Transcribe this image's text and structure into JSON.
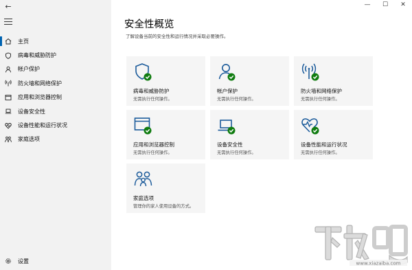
{
  "window": {
    "back_glyph": "←",
    "controls": [
      "—",
      "☐",
      "✕"
    ]
  },
  "sidebar": {
    "items": [
      {
        "label": "主页",
        "icon": "home-icon",
        "active": true
      },
      {
        "label": "病毒和威胁防护",
        "icon": "shield-icon"
      },
      {
        "label": "帐户保护",
        "icon": "person-icon"
      },
      {
        "label": "防火墙和网络保护",
        "icon": "wifi-icon"
      },
      {
        "label": "应用和浏览器控制",
        "icon": "app-window-icon"
      },
      {
        "label": "设备安全性",
        "icon": "laptop-icon"
      },
      {
        "label": "设备性能和运行状况",
        "icon": "heart-icon"
      },
      {
        "label": "家庭选项",
        "icon": "family-icon"
      }
    ],
    "settings_label": "设置"
  },
  "main": {
    "title": "安全性概览",
    "subtitle": "了解设备当前的安全性和运行情况并采取必要操作。",
    "tiles": [
      {
        "title": "病毒和威胁防护",
        "status": "无需执行任何操作。",
        "icon": "shield-check-icon"
      },
      {
        "title": "帐户保护",
        "status": "无需执行任何操作。",
        "icon": "person-check-icon"
      },
      {
        "title": "防火墙和网络保护",
        "status": "无需执行任何操作。",
        "icon": "wifi-check-icon"
      },
      {
        "title": "应用和浏览器控制",
        "status": "无需执行任何操作。",
        "icon": "app-window-check-icon"
      },
      {
        "title": "设备安全性",
        "status": "无需执行任何操作。",
        "icon": "laptop-check-icon"
      },
      {
        "title": "设备性能和运行状况",
        "status": "无需执行任何操作。",
        "icon": "heart-check-icon"
      },
      {
        "title": "家庭选项",
        "status": "管理你的家人使用设备的方式。",
        "icon": "family-icon"
      }
    ]
  },
  "colors": {
    "accent": "#0063b1",
    "icon_blue": "#1a5a9a",
    "check_green": "#107c10",
    "sidebar_bg": "#f2f2f2",
    "tile_bg": "#f5f5f5"
  },
  "watermark": {
    "text": "下载吧",
    "url_text": "www.xiazaiba.com"
  }
}
